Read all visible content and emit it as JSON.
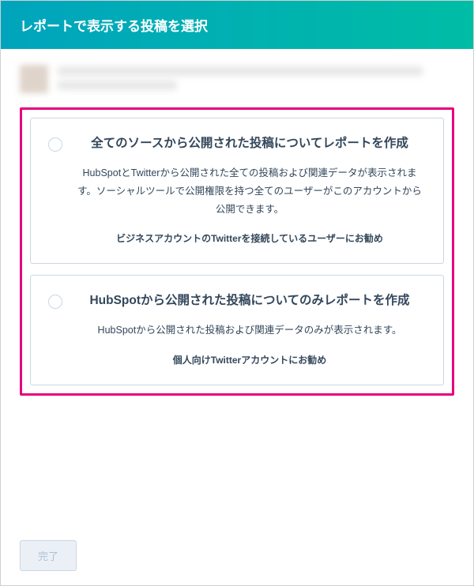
{
  "header": {
    "title": "レポートで表示する投稿を選択"
  },
  "options": [
    {
      "title": "全てのソースから公開された投稿についてレポートを作成",
      "description": "HubSpotとTwitterから公開された全ての投稿および関連データが表示されます。ソーシャルツールで公開権限を持つ全てのユーザーがこのアカウントから公開できます。",
      "recommendation": "ビジネスアカウントのTwitterを接続しているユーザーにお勧め"
    },
    {
      "title": "HubSpotから公開された投稿についてのみレポートを作成",
      "description": "HubSpotから公開された投稿および関連データのみが表示されます。",
      "recommendation": "個人向けTwitterアカウントにお勧め"
    }
  ],
  "footer": {
    "done_label": "完了"
  }
}
